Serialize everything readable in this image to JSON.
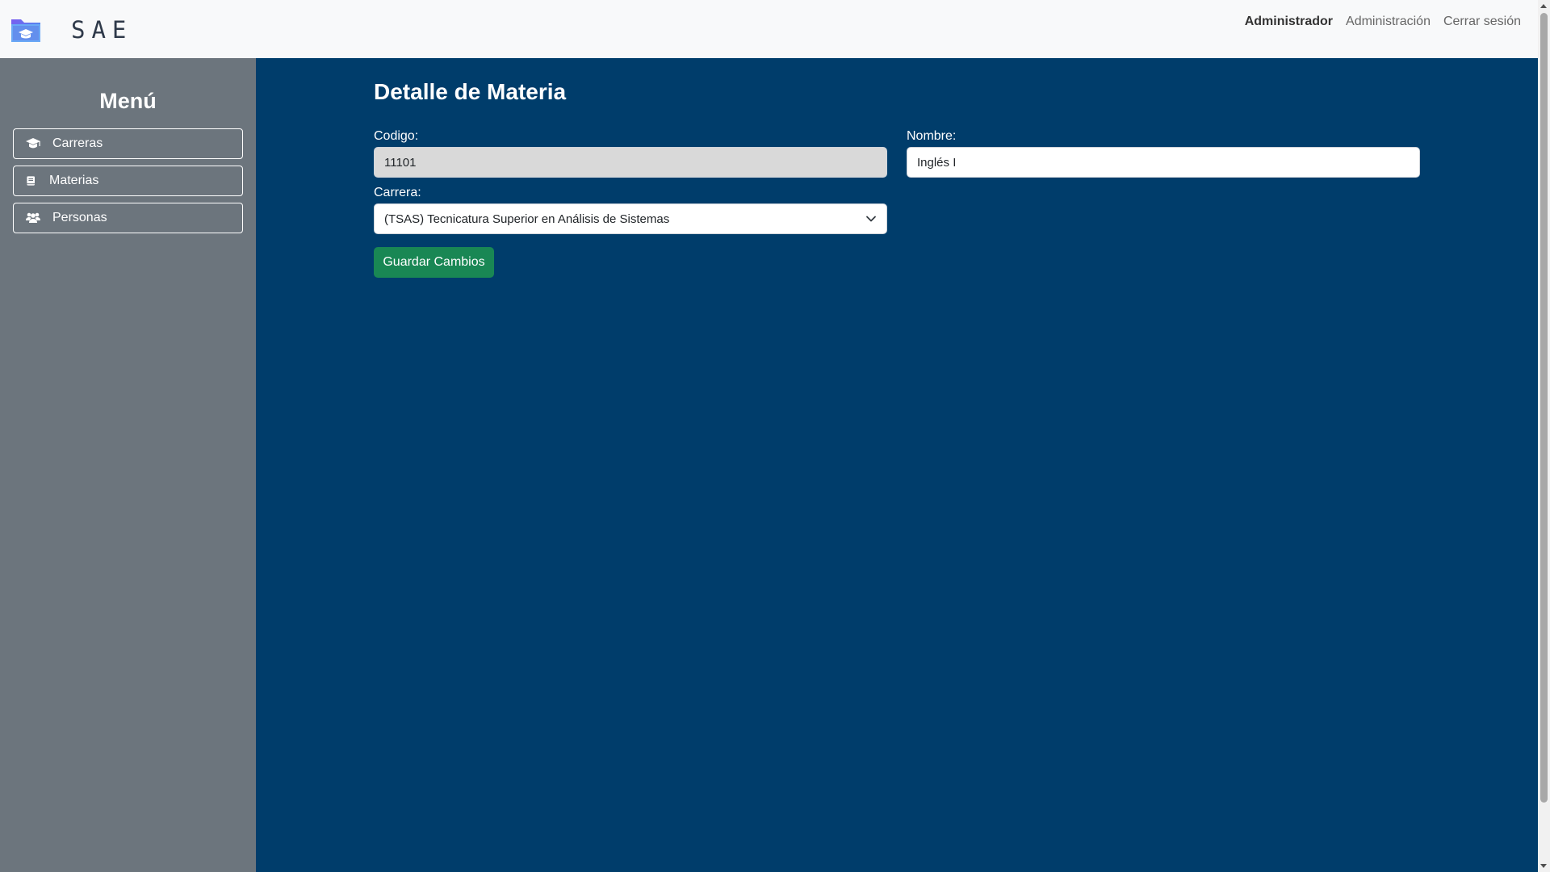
{
  "navbar": {
    "brand_text": "SAE",
    "user_name": "Administrador",
    "admin_link": "Administración",
    "logout_link": "Cerrar sesión",
    "logo_icon": "folder-graduation-cap-icon"
  },
  "sidebar": {
    "title": "Menú",
    "items": [
      {
        "label": "Carreras",
        "icon": "graduation-cap-icon"
      },
      {
        "label": "Materias",
        "icon": "book-icon"
      },
      {
        "label": "Personas",
        "icon": "users-icon"
      }
    ]
  },
  "main": {
    "title": "Detalle de Materia",
    "codigo": {
      "label": "Codigo:",
      "value": "11101"
    },
    "nombre": {
      "label": "Nombre:",
      "value": "Inglés I"
    },
    "carrera": {
      "label": "Carrera:",
      "selected": "(TSAS) Tecnicatura Superior en Análisis de Sistemas"
    },
    "save_button": "Guardar Cambios"
  },
  "colors": {
    "navbar_bg": "#f8f9fa",
    "sidebar_bg": "#6c757d",
    "main_bg": "#003d6b",
    "save_button_bg": "#198754",
    "disabled_input_bg": "#d9d9d9"
  }
}
